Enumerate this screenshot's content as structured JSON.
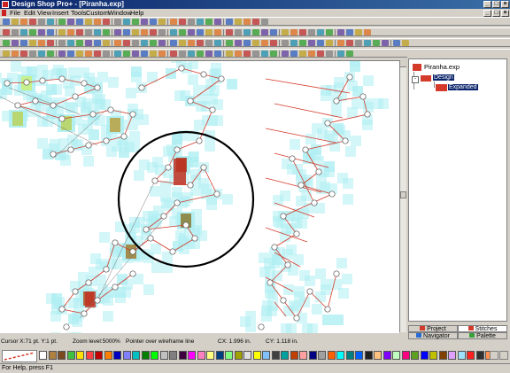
{
  "window": {
    "title": "Design Shop Pro+ - [Piranha.exp]"
  },
  "menu": [
    "File",
    "Edit",
    "View",
    "Insert",
    "Tools",
    "Custom",
    "Window",
    "Help"
  ],
  "tree": {
    "root": "Piranha.exp",
    "design": "Design",
    "expanded": "Expanded"
  },
  "tabs": {
    "project": "Project",
    "stitches": "Stitches",
    "navigator": "Navigator",
    "palette": "Palette"
  },
  "status": {
    "cursor": "Cursor X:71 pt. Y:1 pt.",
    "zoom": "Zoom level:5000%",
    "pointer": "Pointer over wireframe line",
    "cx": "CX: 1.996 in.",
    "cy": "CY: 1.118 in."
  },
  "help": "For Help, press F1",
  "colors": {
    "accent": "#0a246a",
    "stitch": "#d43a2a",
    "fill": "#aeeef2",
    "select_ring": "#000000"
  },
  "palette_colors": [
    "#ffffff",
    "#b08040",
    "#7a4a20",
    "#40c040",
    "#ffe000",
    "#ff4040",
    "#c00000",
    "#ff8000",
    "#0000c0",
    "#8080ff",
    "#00c0c0",
    "#008000",
    "#00ff00",
    "#c0c0c0",
    "#808080",
    "#400040",
    "#ff00ff",
    "#ff80c0",
    "#ffff80",
    "#004080",
    "#80ff80",
    "#a0a000",
    "#e0e0e0",
    "#ffff00",
    "#80c0ff",
    "#404040",
    "#00a0a0",
    "#c04000",
    "#ffa0a0",
    "#000080",
    "#a0a0a0",
    "#ff6000",
    "#00ffff",
    "#008080",
    "#0060ff",
    "#202020",
    "#ffc080",
    "#8000ff",
    "#c0ffc0",
    "#ff0080",
    "#60a020",
    "#0000ff",
    "#c0c000",
    "#804000",
    "#e0a0ff",
    "#a0e0ff",
    "#ff2020",
    "#303030",
    "#ff9050"
  ]
}
